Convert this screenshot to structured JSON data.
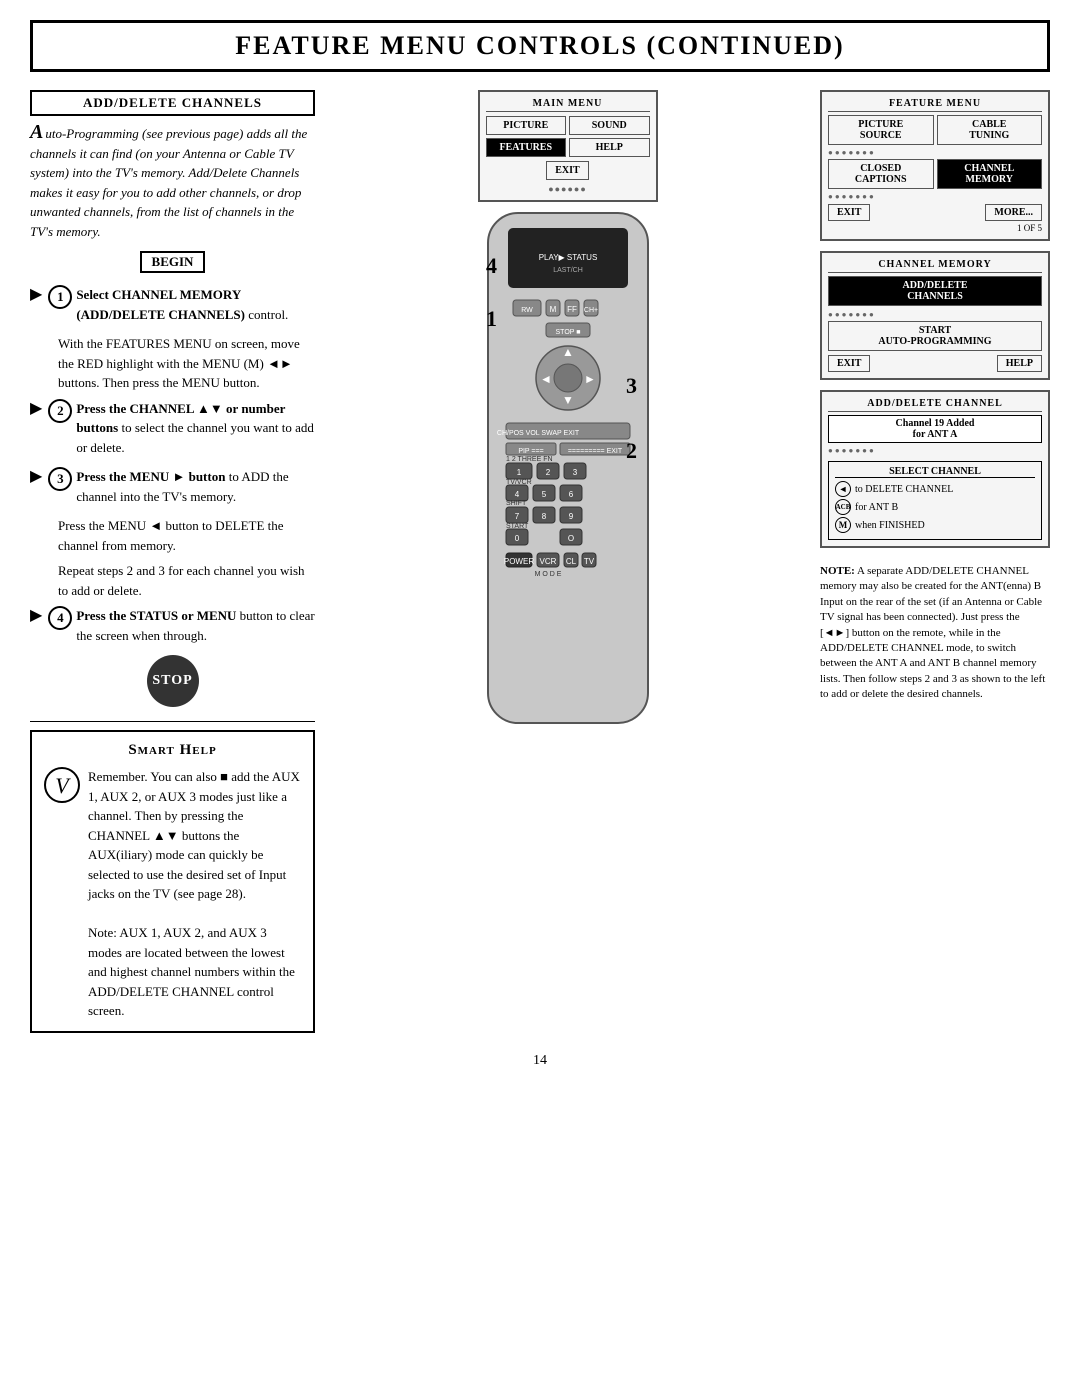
{
  "header": {
    "title": "Feature Menu Controls (Continued)"
  },
  "left": {
    "section_title": "ADD/DELETE CHANNELS",
    "intro": "uto-Programming (see previous page) adds all the channels it can find (on your Antenna or Cable TV system) into the TV's memory. Add/Delete Channels makes it easy for you to add other channels, or drop unwanted channels, from the list of channels in the TV's memory.",
    "begin_label": "BEGIN",
    "steps": [
      {
        "num": "1",
        "label": "Select CHANNEL MEMORY (ADD/DELETE CHANNELS) control.",
        "sub1": "With the FEATURES MENU on screen, move the RED highlight with the MENU (M) ◄► buttons. Then press the MENU button."
      },
      {
        "num": "2",
        "label": "Press the CHANNEL ▲▼ or number buttons to select the channel you want to add or delete."
      },
      {
        "num": "3",
        "label": "Press the MENU ► button to ADD the channel into the TV's memory.",
        "sub1": "Press the MENU ◄ button to DELETE the channel from memory.",
        "sub2": "Repeat steps 2 and 3 for each channel you wish to add or delete."
      },
      {
        "num": "4",
        "label": "Press the STATUS or MENU button to clear the screen when through."
      }
    ],
    "stop_label": "STOP"
  },
  "smart_help": {
    "title": "Smart Help",
    "text": "Remember. You can also add the AUX 1, AUX 2, or AUX 3 modes just like a channel. Then by pressing the CHANNEL ▲▼ buttons the AUX(iliary) mode can quickly be selected to use the desired set of Input jacks on the TV (see page 28).\n\nNote: AUX 1, AUX 2, and AUX 3 modes are located between the lowest and highest channel numbers within the ADD/DELETE CHANNEL control screen."
  },
  "main_menu": {
    "label": "MAIN MENU",
    "items": [
      "PICTURE",
      "SOUND",
      "FEATURES",
      "HELP"
    ],
    "exit": "EXIT",
    "features_highlighted": true
  },
  "feature_menu": {
    "label": "FEATURE MENU",
    "items": [
      {
        "label": "PICTURE SOURCE",
        "highlighted": false
      },
      {
        "label": "CABLE TUNING",
        "highlighted": false
      },
      {
        "label": "CLOSED CAPTIONS",
        "highlighted": false
      },
      {
        "label": "CHANNEL MEMORY",
        "highlighted": true
      }
    ],
    "exit": "EXIT",
    "more": "MORE...",
    "page": "1 OF 5"
  },
  "channel_memory": {
    "label": "CHANNEL MEMORY",
    "items": [
      {
        "label": "ADD/DELETE CHANNELS",
        "highlighted": true
      },
      {
        "label": "START AUTO-PROGRAMMING",
        "highlighted": false
      }
    ],
    "exit": "EXIT",
    "help": "HELP"
  },
  "add_delete": {
    "title": "ADD/DELETE CHANNEL",
    "channel_added": "Channel 19 Added",
    "for_ant": "for ANT A",
    "select_label": "SELECT CHANNEL",
    "row1_icon": "◄",
    "row1_text": "to DELETE CHANNEL",
    "row2_icon": "ACB",
    "row2_text": "for ANT B",
    "row3_icon": "M",
    "row3_text": "when FINISHED"
  },
  "note": {
    "text": "NOTE: A separate ADD/DELETE CHANNEL memory may also be created for the ANT(enna) B Input on the rear of the set (if an Antenna or Cable TV signal has been connected). Just press the [◄►] button on the remote, while in the ADD/DELETE CHANNEL mode, to switch between the ANT A and ANT B channel memory lists. Then follow steps 2 and 3 as shown to the left to add or delete the desired channels."
  },
  "page_number": "14",
  "step_labels": {
    "step1": "1",
    "step2": "2",
    "step3": "3",
    "step4": "4"
  }
}
